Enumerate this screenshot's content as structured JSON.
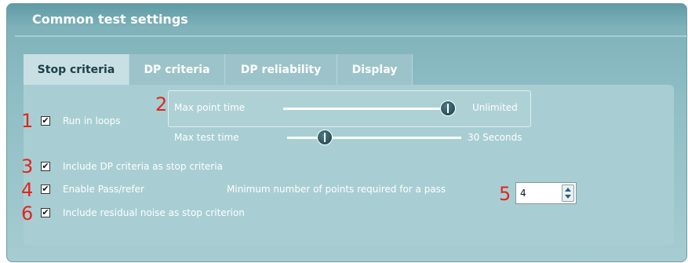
{
  "panel": {
    "title": "Common test settings"
  },
  "tabs": [
    {
      "label": "Stop criteria",
      "active": true
    },
    {
      "label": "DP criteria",
      "active": false
    },
    {
      "label": "DP reliability",
      "active": false
    },
    {
      "label": "Display",
      "active": false
    }
  ],
  "options": {
    "run_in_loops": {
      "label": "Run in loops",
      "checked": true
    },
    "include_dp": {
      "label": "Include DP criteria as stop criteria",
      "checked": true
    },
    "enable_pass": {
      "label": "Enable Pass/refer",
      "checked": true
    },
    "include_noise": {
      "label": "Include residual noise as stop criterion",
      "checked": true
    }
  },
  "sliders": {
    "max_point_time": {
      "label": "Max point time",
      "value_text": "Unlimited",
      "level_percent": 100
    },
    "max_test_time": {
      "label": "Max test time",
      "value_text": "30 Seconds",
      "level_percent": 20
    }
  },
  "min_points": {
    "label": "Minimum number of points required for a pass",
    "value": "4"
  },
  "markers": [
    "1",
    "2",
    "3",
    "4",
    "5",
    "6"
  ],
  "colors": {
    "panel_bg": "#8fbec5",
    "content_bg": "#a8ced3",
    "marker": "#e1261c",
    "thumb": "#1f4651"
  }
}
